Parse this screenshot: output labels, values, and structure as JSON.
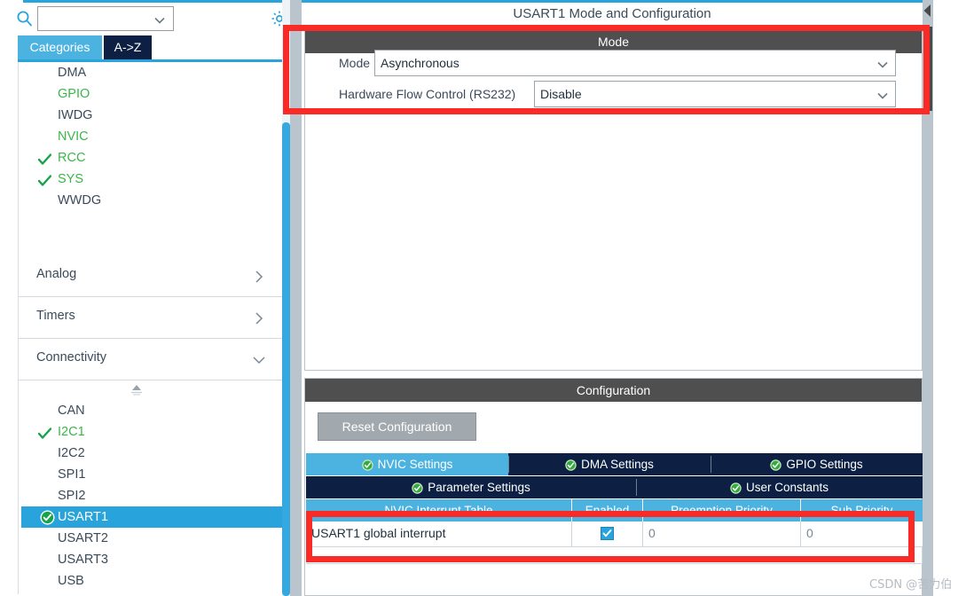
{
  "sidebar": {
    "search": {
      "value": "",
      "placeholder": "",
      "icon": "search-icon"
    },
    "gear_icon": "gear-icon",
    "tabs": [
      {
        "label": "Categories",
        "active": true
      },
      {
        "label": "A->Z",
        "active": false
      }
    ],
    "top_peripherals": [
      {
        "label": "DMA",
        "state": "default",
        "check": false
      },
      {
        "label": "GPIO",
        "state": "green",
        "check": false
      },
      {
        "label": "IWDG",
        "state": "default",
        "check": false
      },
      {
        "label": "NVIC",
        "state": "green",
        "check": false
      },
      {
        "label": "RCC",
        "state": "green",
        "check": true
      },
      {
        "label": "SYS",
        "state": "green",
        "check": true
      },
      {
        "label": "WWDG",
        "state": "default",
        "check": false
      }
    ],
    "groups": [
      {
        "label": "Analog",
        "expanded": false,
        "chevron": "chevron-right-icon"
      },
      {
        "label": "Timers",
        "expanded": false,
        "chevron": "chevron-right-icon"
      },
      {
        "label": "Connectivity",
        "expanded": true,
        "chevron": "chevron-down-icon"
      }
    ],
    "connectivity_items": [
      {
        "label": "CAN",
        "state": "default",
        "check": false,
        "selected": false
      },
      {
        "label": "I2C1",
        "state": "green",
        "check": true,
        "selected": false
      },
      {
        "label": "I2C2",
        "state": "default",
        "check": false,
        "selected": false
      },
      {
        "label": "SPI1",
        "state": "default",
        "check": false,
        "selected": false
      },
      {
        "label": "SPI2",
        "state": "default",
        "check": false,
        "selected": false
      },
      {
        "label": "USART1",
        "state": "default",
        "check": true,
        "selected": true
      },
      {
        "label": "USART2",
        "state": "default",
        "check": false,
        "selected": false
      },
      {
        "label": "USART3",
        "state": "default",
        "check": false,
        "selected": false
      },
      {
        "label": "USB",
        "state": "default",
        "check": false,
        "selected": false
      }
    ]
  },
  "right_pane": {
    "title": "USART1 Mode and Configuration",
    "mode_section": {
      "header": "Mode",
      "fields": [
        {
          "label": "Mode",
          "value": "Asynchronous"
        },
        {
          "label": "Hardware Flow Control (RS232)",
          "value": "Disable"
        }
      ]
    },
    "config_section": {
      "header": "Configuration",
      "reset_button": "Reset Configuration",
      "tabs_row1": [
        {
          "label": "NVIC Settings",
          "active": true
        },
        {
          "label": "DMA Settings",
          "active": false
        },
        {
          "label": "GPIO Settings",
          "active": false
        }
      ],
      "tabs_row2": [
        {
          "label": "Parameter Settings",
          "active": false
        },
        {
          "label": "User Constants",
          "active": false
        }
      ],
      "nvic_table": {
        "columns": [
          "NVIC Interrupt Table",
          "Enabled",
          "Preemption Priority",
          "Sub Priority"
        ],
        "rows": [
          {
            "interrupt": "USART1 global interrupt",
            "enabled": true,
            "preemption_priority": "0",
            "sub_priority": "0"
          }
        ]
      }
    }
  },
  "annotations": {
    "color": "#fa2a26",
    "boxes": [
      "mode-highlight",
      "nvic-row-highlight"
    ]
  },
  "watermark": "CSDN @苦力伯"
}
